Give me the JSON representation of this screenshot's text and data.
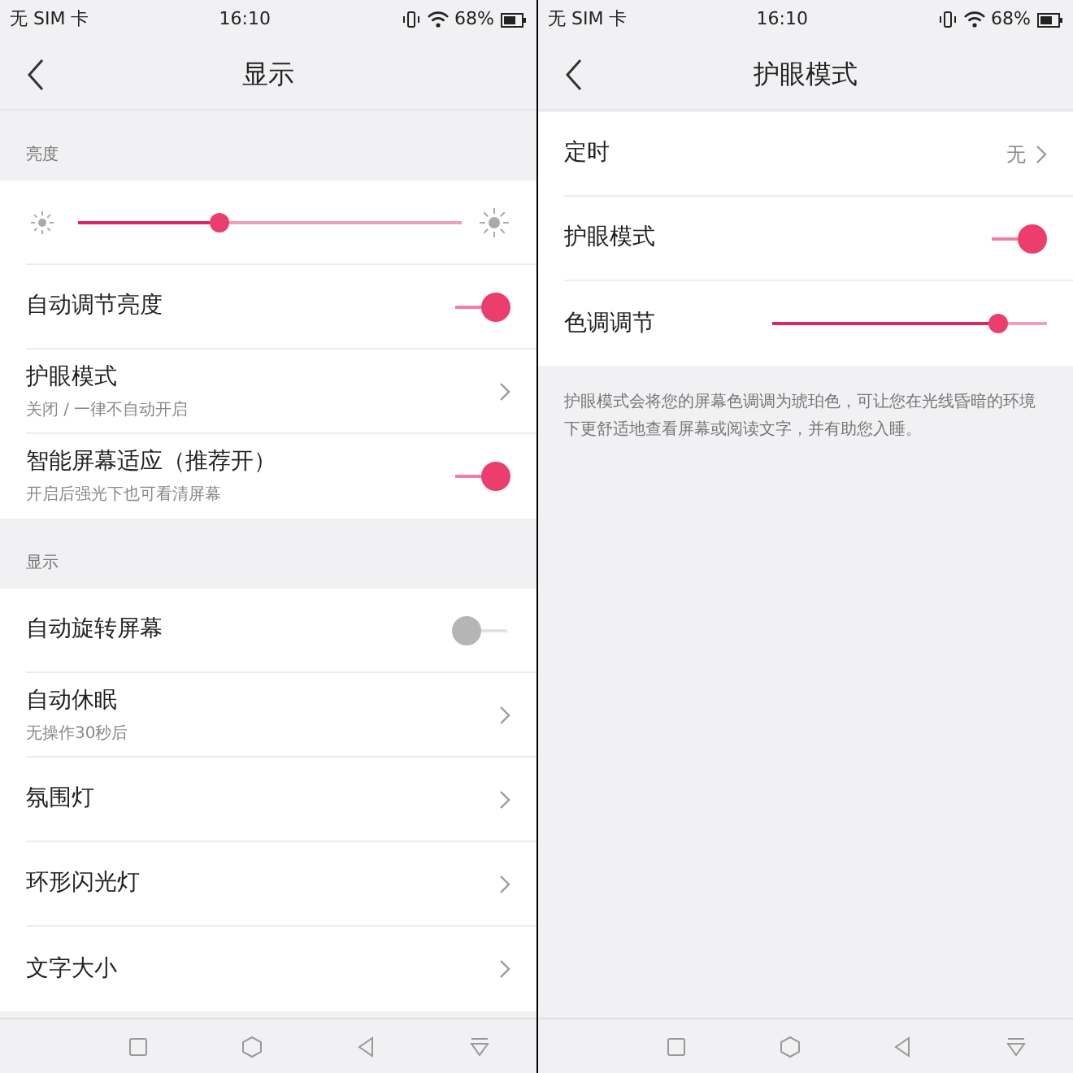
{
  "screens": [
    {
      "status_bar": {
        "carrier": "无 SIM 卡",
        "time": "16:10",
        "battery": "68%"
      },
      "title": "显示",
      "sections": [
        {
          "label": "亮度",
          "items": [
            {
              "kind": "brightness",
              "level": 0.37
            },
            {
              "kind": "switch",
              "label": "自动调节亮度",
              "on": true
            },
            {
              "kind": "link",
              "label": "护眼模式",
              "subtitle": "关闭 / 一律不自动开启"
            },
            {
              "kind": "switch",
              "label": "智能屏幕适应（推荐开）",
              "subtitle": "开启后强光下也可看清屏幕",
              "on": true
            }
          ]
        },
        {
          "label": "显示",
          "items": [
            {
              "kind": "switch",
              "label": "自动旋转屏幕",
              "on": false
            },
            {
              "kind": "link",
              "label": "自动休眠",
              "subtitle": "无操作30秒后"
            },
            {
              "kind": "link",
              "label": "氛围灯"
            },
            {
              "kind": "link",
              "label": "环形闪光灯"
            },
            {
              "kind": "link",
              "label": "文字大小"
            }
          ]
        }
      ]
    },
    {
      "status_bar": {
        "carrier": "无 SIM 卡",
        "time": "16:10",
        "battery": "68%"
      },
      "title": "护眼模式",
      "sections": [
        {
          "items": [
            {
              "kind": "link",
              "label": "定时",
              "value": "无"
            },
            {
              "kind": "switch",
              "label": "护眼模式",
              "on": true
            },
            {
              "kind": "slider",
              "label": "色调调节",
              "level": 0.82
            }
          ],
          "note": "护眼模式会将您的屏幕色调调为琥珀色，可让您在光线昏暗的环境下更舒适地查看屏幕或阅读文字，并有助您入睡。"
        }
      ]
    }
  ]
}
